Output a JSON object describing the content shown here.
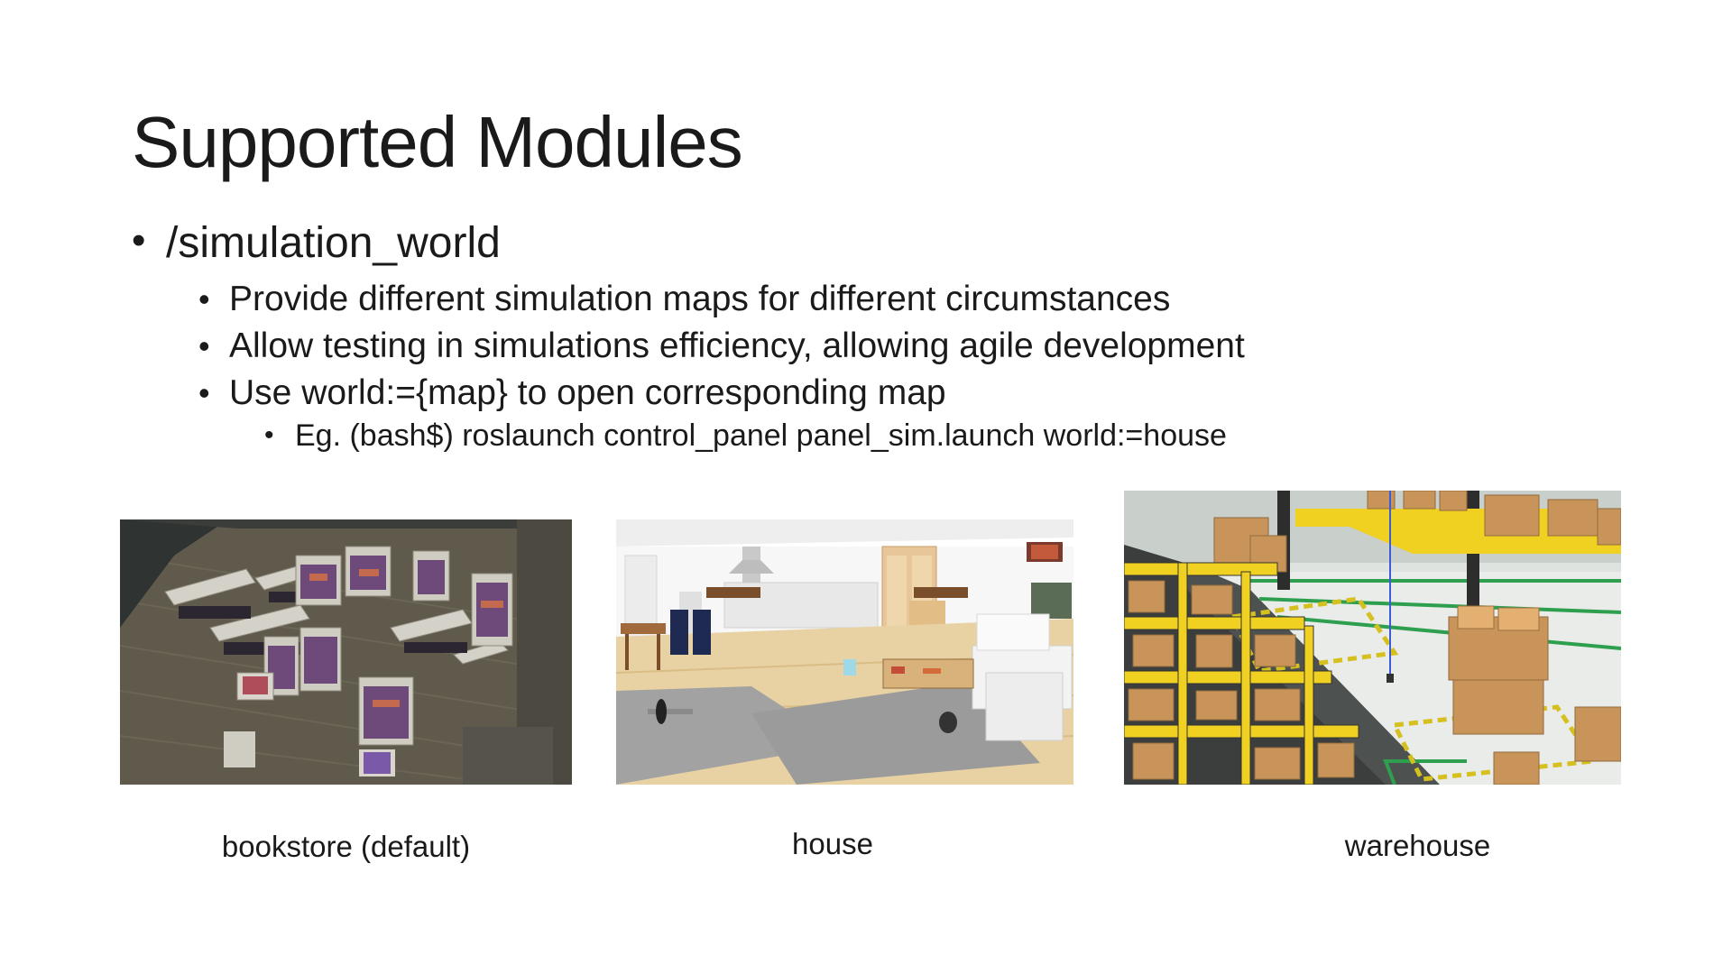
{
  "slide": {
    "title": "Supported Modules",
    "bullets": {
      "level1": "/simulation_world",
      "level2": [
        "Provide different simulation maps for different circumstances",
        "Allow testing in simulations efficiency, allowing agile development",
        "Use world:={map} to open corresponding map"
      ],
      "level3": "Eg. (bash$) roslaunch control_panel panel_sim.launch world:=house"
    },
    "bullet_glyph": "•",
    "images": [
      {
        "caption": "bookstore (default)",
        "scene": "bookstore"
      },
      {
        "caption": "house",
        "scene": "house"
      },
      {
        "caption": "warehouse",
        "scene": "warehouse"
      }
    ]
  }
}
